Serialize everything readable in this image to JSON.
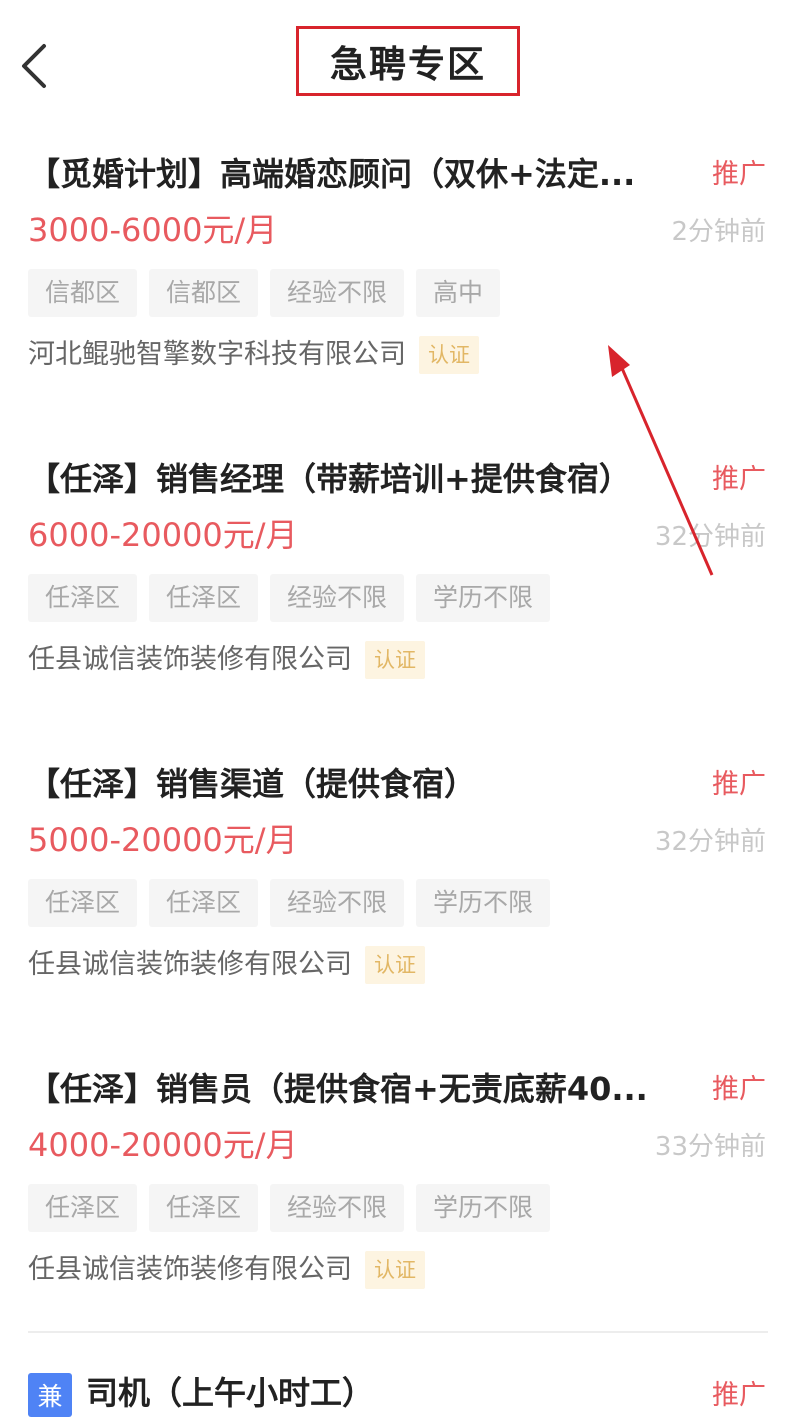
{
  "header": {
    "title": "急聘专区"
  },
  "jobs": [
    {
      "title": "【觅婚计划】高端婚恋顾问（双休+法定...",
      "promo": "推广",
      "salary": "3000-6000元/月",
      "time": "2分钟前",
      "tags": [
        "信都区",
        "信都区",
        "经验不限",
        "高中"
      ],
      "company": "河北鲲驰智擎数字科技有限公司",
      "badge": "认证"
    },
    {
      "title": "【任泽】销售经理（带薪培训+提供食宿）",
      "promo": "推广",
      "salary": "6000-20000元/月",
      "time": "32分钟前",
      "tags": [
        "任泽区",
        "任泽区",
        "经验不限",
        "学历不限"
      ],
      "company": "任县诚信装饰装修有限公司",
      "badge": "认证"
    },
    {
      "title": "【任泽】销售渠道（提供食宿）",
      "promo": "推广",
      "salary": "5000-20000元/月",
      "time": "32分钟前",
      "tags": [
        "任泽区",
        "任泽区",
        "经验不限",
        "学历不限"
      ],
      "company": "任县诚信装饰装修有限公司",
      "badge": "认证"
    },
    {
      "title": "【任泽】销售员（提供食宿+无责底薪40...",
      "promo": "推广",
      "salary": "4000-20000元/月",
      "time": "33分钟前",
      "tags": [
        "任泽区",
        "任泽区",
        "经验不限",
        "学历不限"
      ],
      "company": "任县诚信装饰装修有限公司",
      "badge": "认证"
    }
  ],
  "partial_job": {
    "badge": "兼",
    "title": "司机（上午小时工）",
    "promo": "推广"
  },
  "colors": {
    "accent": "#e85a5f",
    "annotation": "#d8242c",
    "badge_bg": "#fdf4e1",
    "badge_text": "#e2b765",
    "part_time_badge": "#4f83f5"
  },
  "icons": {
    "back": "chevron-left-icon"
  }
}
